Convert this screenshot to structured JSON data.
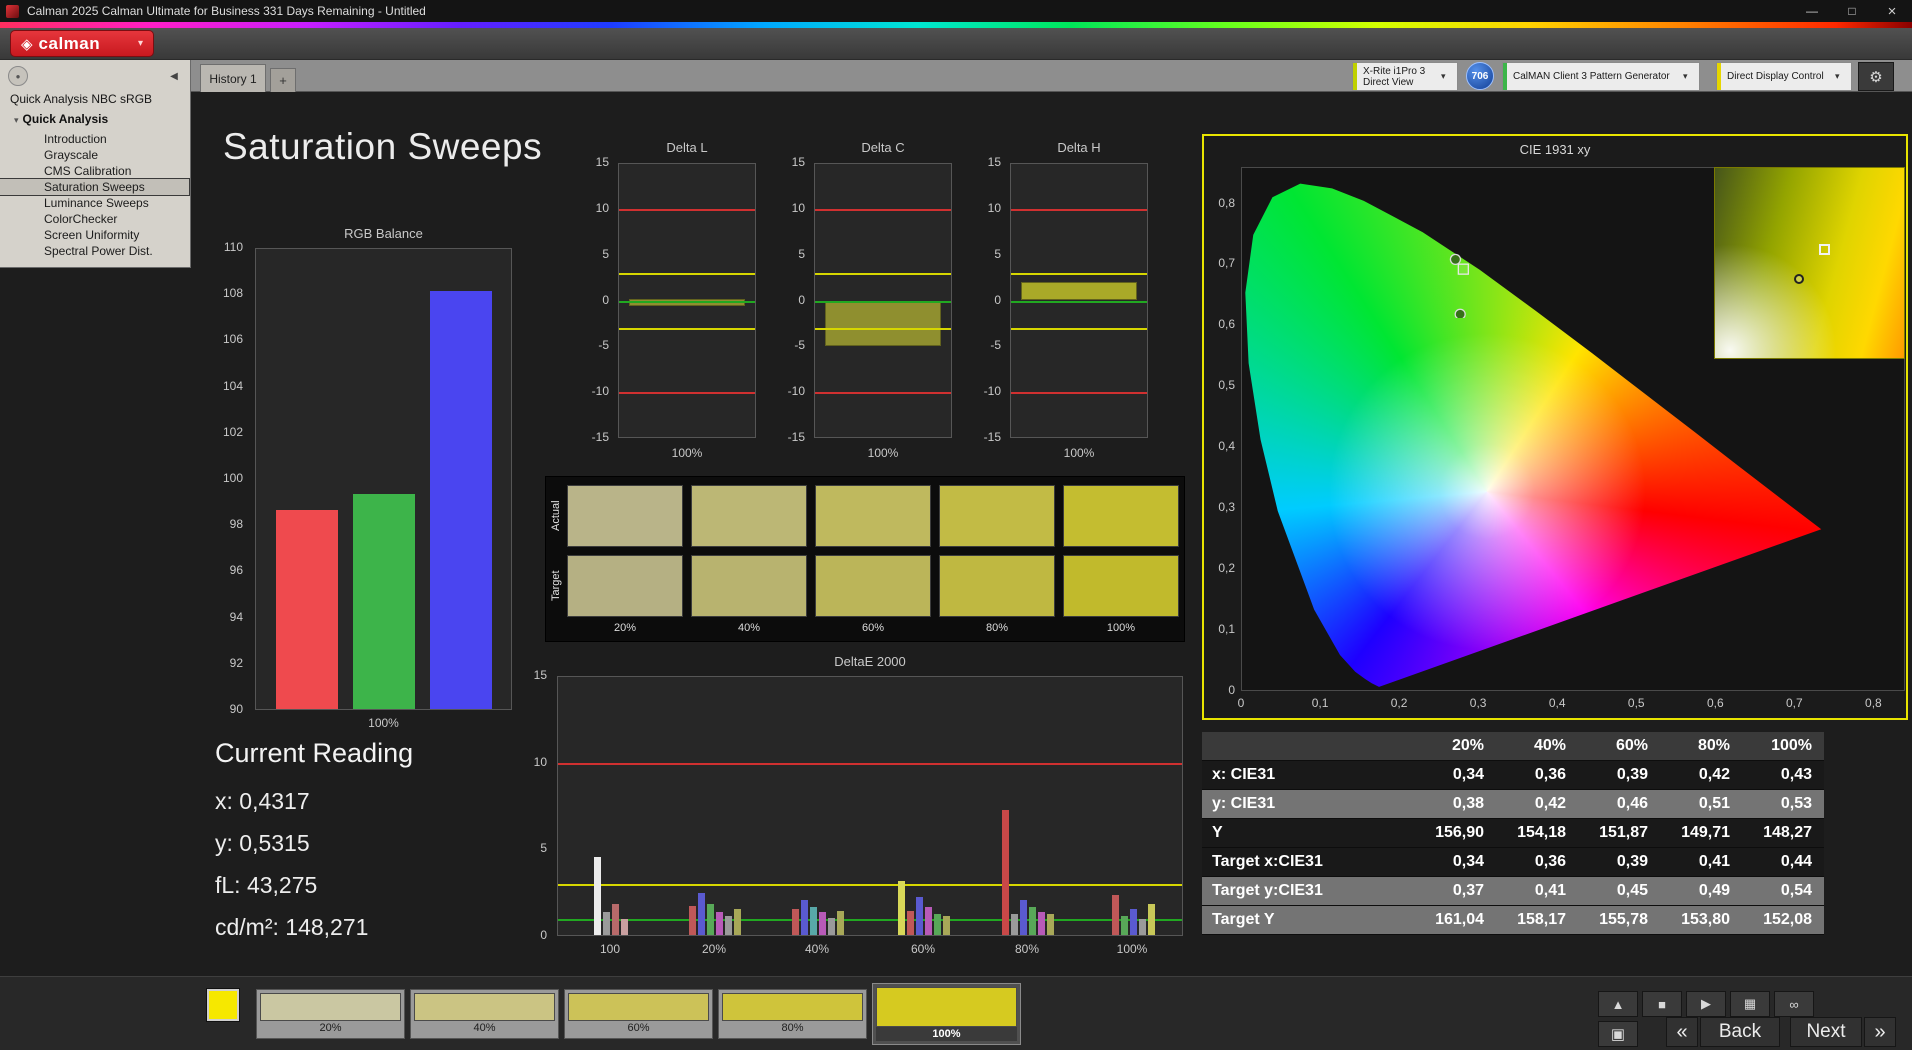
{
  "window": {
    "title": "Calman 2025 Calman Ultimate for Business 331 Days Remaining  - Untitled",
    "minimize": "—",
    "maximize": "□",
    "close": "×"
  },
  "brand": {
    "logo_mark": "◈",
    "logo_text": "calman",
    "menu_arrow": "▾",
    "brand_red": "#c8191f"
  },
  "meter_bar": {
    "meter": {
      "line1": "X-Rite i1Pro 3",
      "line2": "Direct View",
      "arrow": "▾",
      "accent": "#bfd000"
    },
    "badge": "706",
    "badge_color": "#123f95",
    "pattern_generator": {
      "label": "CalMAN Client 3 Pattern Generator",
      "arrow": "▾",
      "accent": "#3cb54a"
    },
    "display_control": {
      "label": "Direct Display Control",
      "arrow": "▾",
      "accent": "#e6d600"
    },
    "settings_icon": "⚙"
  },
  "tab_bar": {
    "history_tab": "History 1",
    "add_tab": "+"
  },
  "sidebar": {
    "collapse_icon": "◀",
    "header": "Quick Analysis NBC sRGB",
    "expander_icon": "▾",
    "root_item": "Quick Analysis",
    "items": [
      "Introduction",
      "Grayscale",
      "CMS Calibration",
      "Saturation Sweeps",
      "Luminance Sweeps",
      "ColorChecker",
      "Screen Uniformity",
      "Spectral Power Dist."
    ],
    "selected": "Saturation Sweeps"
  },
  "page": {
    "title": "Saturation Sweeps"
  },
  "current_reading": {
    "title": "Current Reading",
    "x": "x: 0,4317",
    "y": "y: 0,5315",
    "fl": "fL: 43,275",
    "cdm2": "cd/m²: 148,271"
  },
  "chart_data": [
    {
      "id": "rgb_balance",
      "type": "bar",
      "title": "RGB Balance",
      "categories": [
        "Red",
        "Green",
        "Blue"
      ],
      "values": [
        98.6,
        99.3,
        108.1
      ],
      "colors": [
        "#ef4a4e",
        "#3db44a",
        "#4a45f0"
      ],
      "ylim": [
        90,
        110
      ],
      "yticks": [
        110,
        108,
        106,
        104,
        102,
        100,
        98,
        96,
        94,
        92,
        90
      ],
      "xlabel": "100%"
    },
    {
      "id": "delta_l",
      "type": "bar",
      "title": "Delta L",
      "ylim": [
        -15,
        15
      ],
      "yticks": [
        15,
        10,
        5,
        0,
        -5,
        -10,
        -15
      ],
      "limit_lines": {
        "red": [
          10,
          -10
        ],
        "yellow": [
          3,
          -3
        ],
        "green": [
          0
        ]
      },
      "bar_range": [
        0.3,
        -0.5
      ],
      "bar_color": "#8f8f2f",
      "xlabel": "100%"
    },
    {
      "id": "delta_c",
      "type": "bar",
      "title": "Delta C",
      "ylim": [
        -15,
        15
      ],
      "yticks": [
        15,
        10,
        5,
        0,
        -5,
        -10,
        -15
      ],
      "limit_lines": {
        "red": [
          10,
          -10
        ],
        "yellow": [
          3,
          -3
        ],
        "green": [
          0
        ]
      },
      "bar_range": [
        0,
        -4.8
      ],
      "bar_color": "#8f8f2f",
      "xlabel": "100%"
    },
    {
      "id": "delta_h",
      "type": "bar",
      "title": "Delta H",
      "ylim": [
        -15,
        15
      ],
      "yticks": [
        15,
        10,
        5,
        0,
        -5,
        -10,
        -15
      ],
      "limit_lines": {
        "red": [
          10,
          -10
        ],
        "yellow": [
          3,
          -3
        ],
        "green": [
          0
        ]
      },
      "bar_range": [
        2.1,
        0.2
      ],
      "bar_color": "#a9a928",
      "xlabel": "100%"
    },
    {
      "id": "delta_e_2000",
      "type": "bar",
      "title": "DeltaE 2000",
      "ylim": [
        0,
        15
      ],
      "yticks": [
        15,
        10,
        5,
        0
      ],
      "limit_lines": {
        "red": [
          10
        ],
        "yellow": [
          3
        ],
        "green": [
          1
        ]
      },
      "groups": [
        {
          "label": "100",
          "bars": [
            {
              "c": "#ececec",
              "v": 4.5
            },
            {
              "c": "#9a9a9a",
              "v": 1.3
            },
            {
              "c": "#b86a6a",
              "v": 1.8
            },
            {
              "c": "#caa0a0",
              "v": 0.9
            }
          ]
        },
        {
          "label": "20%",
          "bars": [
            {
              "c": "#c05858",
              "v": 1.7
            },
            {
              "c": "#5a5ad0",
              "v": 2.4
            },
            {
              "c": "#58a858",
              "v": 1.8
            },
            {
              "c": "#b85ab8",
              "v": 1.3
            },
            {
              "c": "#9a9a9a",
              "v": 1.1
            },
            {
              "c": "#a8a858",
              "v": 1.5
            }
          ]
        },
        {
          "label": "40%",
          "bars": [
            {
              "c": "#c05858",
              "v": 1.5
            },
            {
              "c": "#5a5ad0",
              "v": 2.0
            },
            {
              "c": "#58a8a8",
              "v": 1.6
            },
            {
              "c": "#b85ab8",
              "v": 1.3
            },
            {
              "c": "#9a9a9a",
              "v": 1.0
            },
            {
              "c": "#a8a858",
              "v": 1.4
            }
          ]
        },
        {
          "label": "60%",
          "bars": [
            {
              "c": "#d8d858",
              "v": 3.1
            },
            {
              "c": "#c05858",
              "v": 1.4
            },
            {
              "c": "#5a5ad0",
              "v": 2.2
            },
            {
              "c": "#b85ab8",
              "v": 1.6
            },
            {
              "c": "#58a858",
              "v": 1.2
            },
            {
              "c": "#a8a858",
              "v": 1.1
            }
          ]
        },
        {
          "label": "80%",
          "bars": [
            {
              "c": "#c84848",
              "v": 7.2
            },
            {
              "c": "#9a9a9a",
              "v": 1.2
            },
            {
              "c": "#5a5ad0",
              "v": 2.0
            },
            {
              "c": "#58a858",
              "v": 1.6
            },
            {
              "c": "#b85ab8",
              "v": 1.3
            },
            {
              "c": "#a8a858",
              "v": 1.2
            }
          ]
        },
        {
          "label": "100%",
          "bars": [
            {
              "c": "#c05858",
              "v": 2.3
            },
            {
              "c": "#58a858",
              "v": 1.1
            },
            {
              "c": "#5a5ad0",
              "v": 1.5
            },
            {
              "c": "#9a9a9a",
              "v": 0.9
            },
            {
              "c": "#c8c858",
              "v": 1.8
            }
          ]
        }
      ]
    },
    {
      "id": "cie_1931",
      "type": "scatter",
      "title": "CIE 1931 xy",
      "xticks": [
        "0",
        "0,1",
        "0,2",
        "0,3",
        "0,4",
        "0,5",
        "0,6",
        "0,7",
        "0,8"
      ],
      "yticks": [
        "0",
        "0,1",
        "0,2",
        "0,3",
        "0,4",
        "0,5",
        "0,6",
        "0,7",
        "0,8"
      ],
      "plot_xmax": 0.84,
      "plot_ymax": 0.86,
      "measured": [
        [
          0.19,
          0.332
        ],
        [
          0.212,
          0.332
        ],
        [
          0.235,
          0.332
        ],
        [
          0.258,
          0.331
        ],
        [
          0.282,
          0.33
        ],
        [
          0.3,
          0.33
        ],
        [
          0.3127,
          0.329
        ],
        [
          0.382,
          0.333
        ],
        [
          0.452,
          0.335
        ],
        [
          0.522,
          0.336
        ],
        [
          0.601,
          0.336
        ],
        [
          0.68,
          0.332
        ],
        [
          0.296,
          0.432
        ],
        [
          0.289,
          0.477
        ],
        [
          0.282,
          0.54
        ],
        [
          0.276,
          0.62
        ],
        [
          0.27,
          0.71
        ],
        [
          0.35,
          0.372
        ],
        [
          0.371,
          0.412
        ],
        [
          0.392,
          0.452
        ],
        [
          0.411,
          0.491
        ],
        [
          0.432,
          0.531
        ],
        [
          0.316,
          0.296
        ],
        [
          0.312,
          0.261
        ],
        [
          0.306,
          0.226
        ],
        [
          0.3,
          0.191
        ],
        [
          0.29,
          0.281
        ],
        [
          0.265,
          0.241
        ],
        [
          0.24,
          0.196
        ],
        [
          0.214,
          0.15
        ],
        [
          0.155,
          0.064
        ]
      ],
      "targets": [
        [
          0.197,
          0.329
        ],
        [
          0.225,
          0.329
        ],
        [
          0.378,
          0.329
        ],
        [
          0.444,
          0.329
        ],
        [
          0.509,
          0.329
        ],
        [
          0.575,
          0.329
        ],
        [
          0.64,
          0.329
        ],
        [
          0.303,
          0.546
        ],
        [
          0.3,
          0.6
        ],
        [
          0.28,
          0.694
        ],
        [
          0.399,
          0.47
        ],
        [
          0.42,
          0.505
        ],
        [
          0.44,
          0.54
        ],
        [
          0.248,
          0.221
        ],
        [
          0.215,
          0.168
        ],
        [
          0.183,
          0.114
        ],
        [
          0.15,
          0.06
        ],
        [
          0.32,
          0.154
        ],
        [
          0.3127,
          0.329
        ]
      ]
    }
  ],
  "sweep_swatches": {
    "row_labels": [
      "Actual",
      "Target"
    ],
    "col_labels": [
      "20%",
      "40%",
      "60%",
      "80%",
      "100%"
    ],
    "actual_colors": [
      "#b9b489",
      "#bcb775",
      "#bfb95e",
      "#c2bb45",
      "#c4bd30"
    ],
    "target_colors": [
      "#b5b083",
      "#b8b36f",
      "#bbb559",
      "#bfb841",
      "#c1ba2c"
    ]
  },
  "results_table": {
    "col_headers": [
      "20%",
      "40%",
      "60%",
      "80%",
      "100%"
    ],
    "rows": [
      {
        "label": "x: CIE31",
        "values": [
          "0,34",
          "0,36",
          "0,39",
          "0,42",
          "0,43"
        ]
      },
      {
        "label": "y: CIE31",
        "values": [
          "0,38",
          "0,42",
          "0,46",
          "0,51",
          "0,53"
        ]
      },
      {
        "label": "Y",
        "values": [
          "156,90",
          "154,18",
          "151,87",
          "149,71",
          "148,27"
        ]
      },
      {
        "label": "Target x:CIE31",
        "values": [
          "0,34",
          "0,36",
          "0,39",
          "0,41",
          "0,44"
        ]
      },
      {
        "label": "Target y:CIE31",
        "values": [
          "0,37",
          "0,41",
          "0,45",
          "0,49",
          "0,54"
        ]
      },
      {
        "label": "Target Y",
        "values": [
          "161,04",
          "158,17",
          "155,78",
          "153,80",
          "152,08"
        ]
      }
    ]
  },
  "bottom_bar": {
    "pattern_color": "#f6e800",
    "pattern_swatches": [
      {
        "label": "20%",
        "color": "#cac7a2"
      },
      {
        "label": "40%",
        "color": "#cbc483"
      },
      {
        "label": "60%",
        "color": "#ccc258"
      },
      {
        "label": "80%",
        "color": "#cfc43b"
      },
      {
        "label": "100%",
        "color": "#d6ca20",
        "selected": true
      }
    ],
    "transport": [
      {
        "name": "panel-up",
        "icon": "▲"
      },
      {
        "name": "stop",
        "icon": "■"
      },
      {
        "name": "play",
        "icon": "▶"
      },
      {
        "name": "save",
        "icon": "▦"
      },
      {
        "name": "link",
        "icon": "∞"
      }
    ],
    "pattern_window_icon": "▣",
    "back_chevron": "«",
    "back": "Back",
    "next": "Next",
    "next_chevron": "»"
  }
}
